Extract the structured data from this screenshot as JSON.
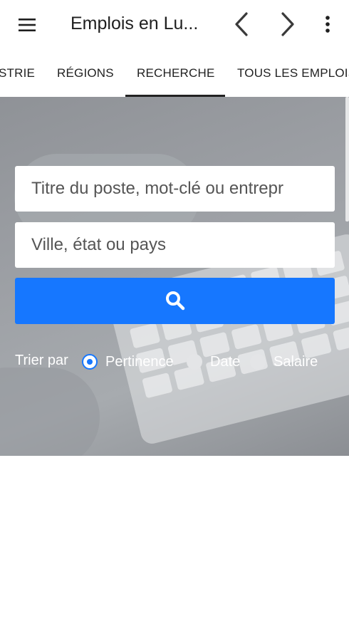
{
  "appbar": {
    "title": "Emplois en Lu...",
    "menu_icon": "hamburger-menu-icon",
    "back_icon": "chevron-left-icon",
    "forward_icon": "chevron-right-icon",
    "more_icon": "more-vertical-icon"
  },
  "tabs": [
    {
      "label": "STRIE"
    },
    {
      "label": "RÉGIONS"
    },
    {
      "label": "RECHERCHE",
      "selected": true
    },
    {
      "label": "TOUS LES EMPLOIS"
    }
  ],
  "search": {
    "keyword_placeholder": "Titre du poste, mot-clé ou entrepr",
    "location_placeholder": "Ville, état ou pays",
    "button_icon": "search-icon"
  },
  "sort": {
    "label": "Trier par",
    "options": [
      {
        "label": "Pertinence",
        "selected": true
      },
      {
        "label": "Date",
        "selected": false
      },
      {
        "label": "Salaire",
        "selected": false
      }
    ]
  },
  "colors": {
    "accent": "#1677ff",
    "tab_text": "#222222"
  }
}
